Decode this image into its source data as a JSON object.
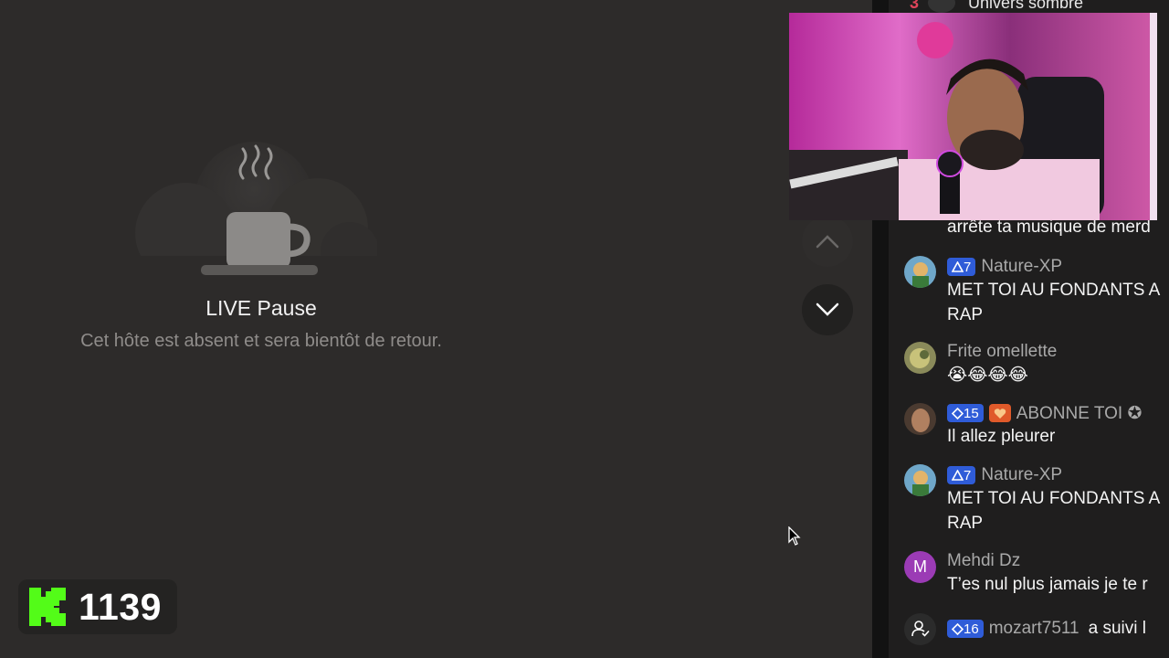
{
  "player": {
    "status_title": "LIVE Pause",
    "status_message": "Cet hôte est absent et sera bientôt de retour.",
    "nav_up_icon": "chevron-up-icon",
    "nav_down_icon": "chevron-down-icon"
  },
  "kick_badge": {
    "logo_icon": "kick-logo-icon",
    "count": "1139",
    "brand_color": "#53fc18"
  },
  "chat": {
    "top_item": {
      "rank": "3",
      "label": "Univers sombre"
    },
    "overflow_text": "arrête ta musique de merd",
    "messages": [
      {
        "badge": "7",
        "badge_icon": "triangle-icon",
        "username": "Nature-XP",
        "lines": [
          "MET TOI AU FONDANTS A",
          "RAP"
        ]
      },
      {
        "username": "Frite omellette",
        "lines": [
          "😭😂😂😂"
        ]
      },
      {
        "badge": "15",
        "badge_icon": "diamond-icon",
        "extra_badge": "heart-icon",
        "username": "ABONNE TOI ✪",
        "lines": [
          "Il allez pleurer"
        ]
      },
      {
        "badge": "7",
        "badge_icon": "triangle-icon",
        "username": "Nature-XP",
        "lines": [
          "MET TOI AU FONDANTS A",
          "RAP"
        ]
      },
      {
        "avatar_letter": "M",
        "username": "Mehdi Dz",
        "lines": [
          "T’es nul plus jamais je te r"
        ]
      }
    ],
    "follow_event": {
      "icon": "user-follow-icon",
      "badge": "16",
      "username": "mozart7511",
      "action": "a suivi l"
    }
  }
}
